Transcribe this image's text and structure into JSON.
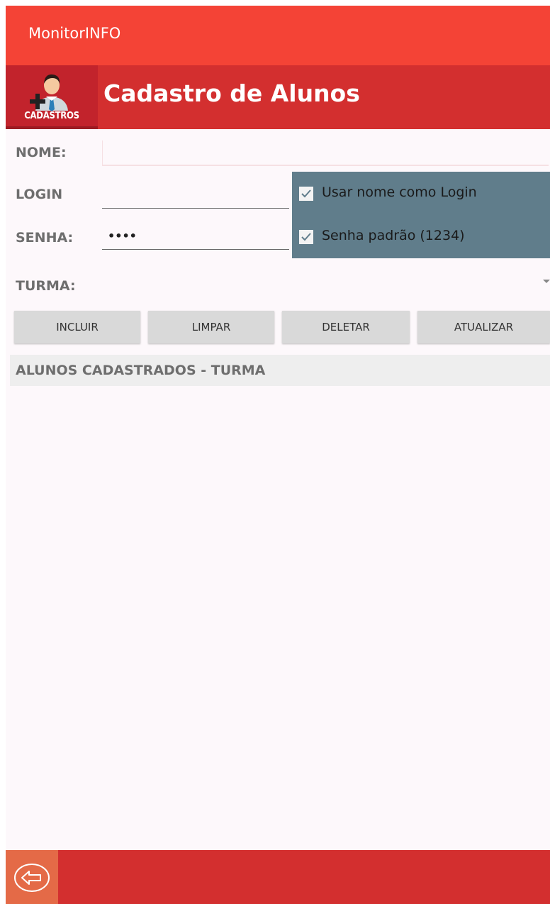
{
  "app": {
    "title": "MonitorINFO"
  },
  "header": {
    "logo_text": "CADASTROS",
    "page_title": "Cadastro de Alunos"
  },
  "form": {
    "nome": {
      "label": "NOME:",
      "value": ""
    },
    "login": {
      "label": "LOGIN",
      "value": ""
    },
    "senha": {
      "label": "SENHA:",
      "value": "••••"
    },
    "turma": {
      "label": "TURMA:",
      "selected": ""
    }
  },
  "options": {
    "use_name_as_login": {
      "label": "Usar nome como Login",
      "checked": true
    },
    "default_password": {
      "label": "Senha padrão (1234)",
      "checked": true
    }
  },
  "buttons": {
    "incluir": "INCLUIR",
    "limpar": "LIMPAR",
    "deletar": "DELETAR",
    "atualizar": "ATUALIZAR"
  },
  "list": {
    "header": "ALUNOS CADASTRADOS - TURMA",
    "items": []
  },
  "icons": {
    "logo": "add-user-icon",
    "back": "back-arrow-icon",
    "checkbox": "checkmark-icon",
    "dropdown": "caret-down-icon"
  },
  "colors": {
    "titlebar": "#f44336",
    "header": "#d32f2f",
    "options_panel": "#607d8b",
    "footer": "#d32f2f",
    "back_button": "#e46a47"
  }
}
